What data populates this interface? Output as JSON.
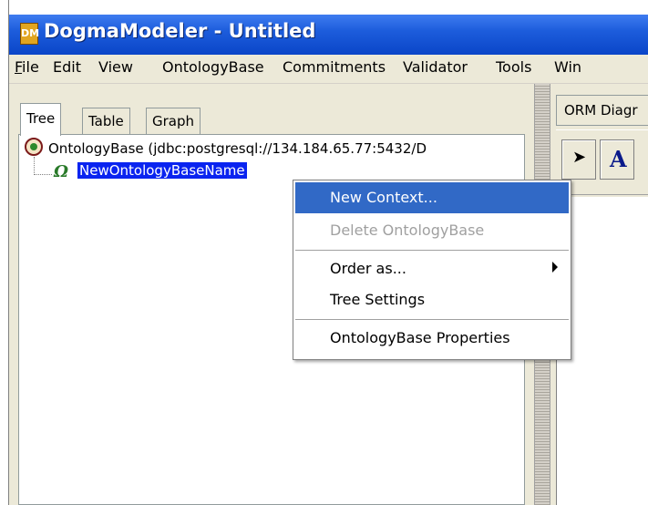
{
  "window": {
    "title": "DogmaModeler  - Untitled",
    "icon_text": "DM"
  },
  "menubar": {
    "items": [
      "File",
      "Edit",
      "View",
      "OntologyBase",
      "Commitments",
      "Validator",
      "Tools",
      "Win"
    ]
  },
  "left_tabs": [
    "Tree",
    "Table",
    "Graph"
  ],
  "tree": {
    "root_label": "OntologyBase (jdbc:postgresql://134.184.65.77:5432/D",
    "child_label": "NewOntologyBaseName"
  },
  "right_pane": {
    "tab_label": "ORM Diagr",
    "tool_text": "A"
  },
  "context_menu": {
    "items": [
      {
        "label": "New Context...",
        "state": "highlighted"
      },
      {
        "label": "Delete OntologyBase",
        "state": "disabled"
      },
      {
        "label": "Order as...",
        "state": "normal",
        "submenu": true
      },
      {
        "label": "Tree Settings",
        "state": "normal"
      },
      {
        "label": "OntologyBase Properties",
        "state": "normal"
      }
    ]
  },
  "colors": {
    "titlebar": "#0a45c8",
    "selection": "#0a24f0",
    "menu_highlight": "#3169c6",
    "chrome": "#ece9d8"
  }
}
